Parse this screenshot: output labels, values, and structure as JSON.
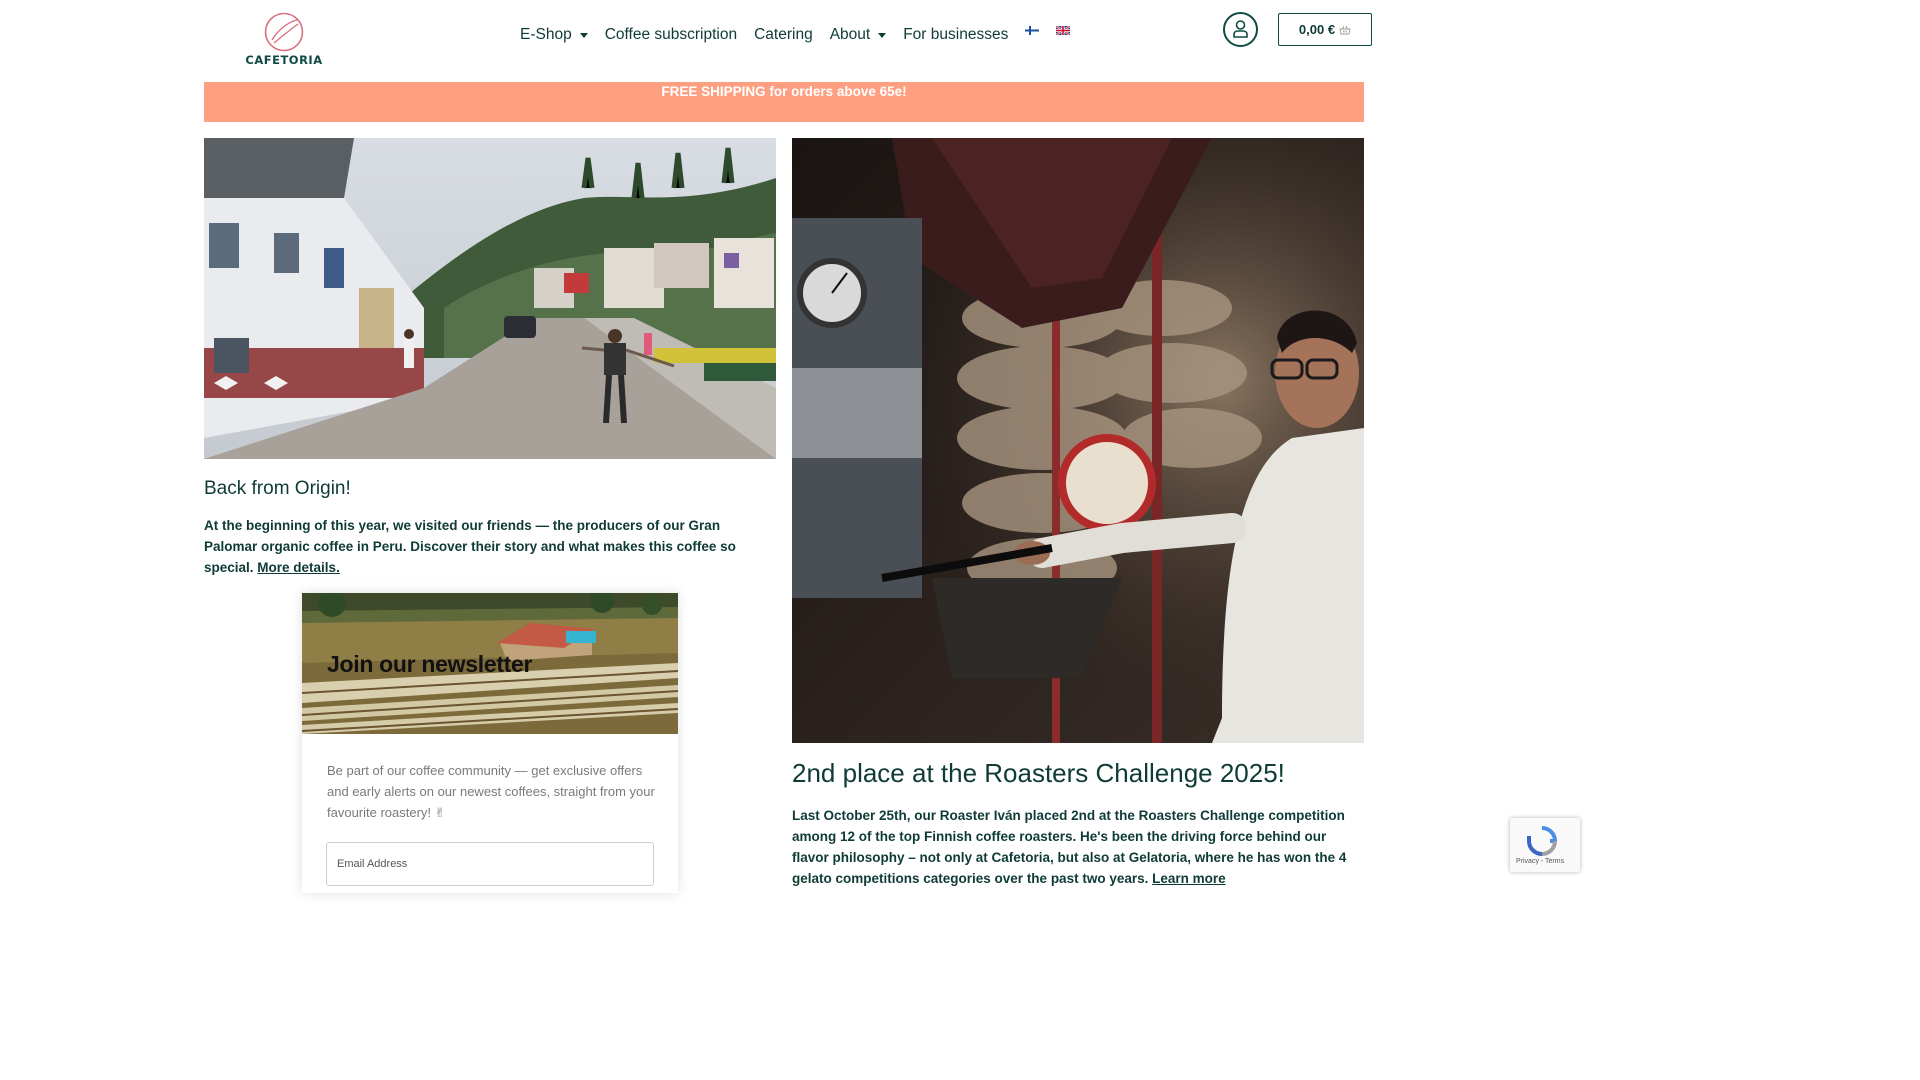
{
  "header": {
    "logo_text": "CAFETORIA",
    "nav": [
      {
        "label": "E-Shop",
        "has_dropdown": true
      },
      {
        "label": "Coffee subscription",
        "has_dropdown": false
      },
      {
        "label": "Catering",
        "has_dropdown": false
      },
      {
        "label": "About",
        "has_dropdown": true
      },
      {
        "label": "For businesses",
        "has_dropdown": false
      }
    ],
    "languages": [
      "finnish-flag-icon",
      "english-flag-icon"
    ],
    "account_icon": "user-icon",
    "cart_total": "0,00 €",
    "cart_icon": "basket-icon"
  },
  "banner": {
    "text": "FREE SHIPPING for orders above 65e!",
    "color": "#ff9f82"
  },
  "posts": [
    {
      "title": "Back from Origin!",
      "body": "At the beginning of this year, we visited our friends — the producers of our Gran Palomar organic coffee in Peru. Discover their story and what makes this coffee so special.",
      "link": "More details."
    },
    {
      "title": "2nd place at the Roasters Challenge 2025!",
      "body": "Last October 25th, our Roaster Iván placed 2nd at the Roasters Challenge competition among 12 of the top Finnish coffee roasters. He's been the driving force behind our flavor philosophy – not only at Cafetoria, but also at Gelatoria, where he has won the 4 gelato competitions categories over the past two years.",
      "link": "Learn more"
    }
  ],
  "newsletter": {
    "title": "Join our newsletter",
    "text": "Be part of our coffee community — get exclusive offers and early alerts on our newest coffees, straight from your favourite roastery! ✌",
    "email_placeholder": "Email Address"
  },
  "recaptcha": {
    "links": "Privacy - Terms"
  },
  "colors": {
    "brand_dark": "#0f3b36",
    "accent_pink": "#d9707d"
  }
}
